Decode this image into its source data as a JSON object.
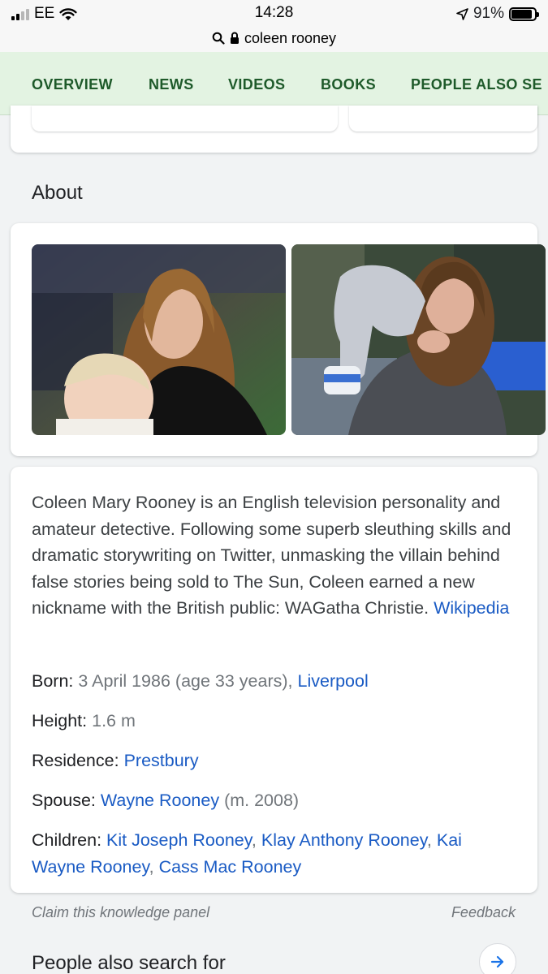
{
  "status_bar": {
    "carrier": "EE",
    "time": "14:28",
    "battery": "91%",
    "battery_level": 0.91
  },
  "url_bar": {
    "query": "coleen rooney"
  },
  "tabs": [
    {
      "label": "OVERVIEW"
    },
    {
      "label": "NEWS"
    },
    {
      "label": "VIDEOS"
    },
    {
      "label": "BOOKS"
    },
    {
      "label": "PEOPLE ALSO SE"
    }
  ],
  "about": {
    "heading": "About",
    "description": "Coleen Mary Rooney is an English television personality and amateur detective. Following some superb sleuthing skills and dramatic storywriting on Twitter, unmasking the villain behind false stories being sold to The Sun, Coleen earned a new nickname with the British public: WAGatha Christie.",
    "source_link": "Wikipedia",
    "facts": {
      "born": {
        "label": "Born:",
        "value": "3 April 1986 (age 33 years),",
        "link": "Liverpool"
      },
      "height": {
        "label": "Height:",
        "value": "1.6 m"
      },
      "residence": {
        "label": "Residence:",
        "link": "Prestbury"
      },
      "spouse": {
        "label": "Spouse:",
        "link": "Wayne Rooney",
        "value": "(m. 2008)"
      },
      "children": {
        "label": "Children:",
        "child1": "Kit Joseph Rooney",
        "child2": "Klay Anthony Rooney",
        "child3": "Kai Wayne Rooney",
        "child4": "Cass Mac Rooney"
      }
    }
  },
  "footer": {
    "claim": "Claim this knowledge panel",
    "feedback": "Feedback"
  },
  "people_also_search": {
    "heading": "People also search for"
  },
  "colors": {
    "accent_green": "#1e8e3e",
    "tab_bg": "#e3f3e2",
    "link_blue": "#1a5bc4"
  }
}
